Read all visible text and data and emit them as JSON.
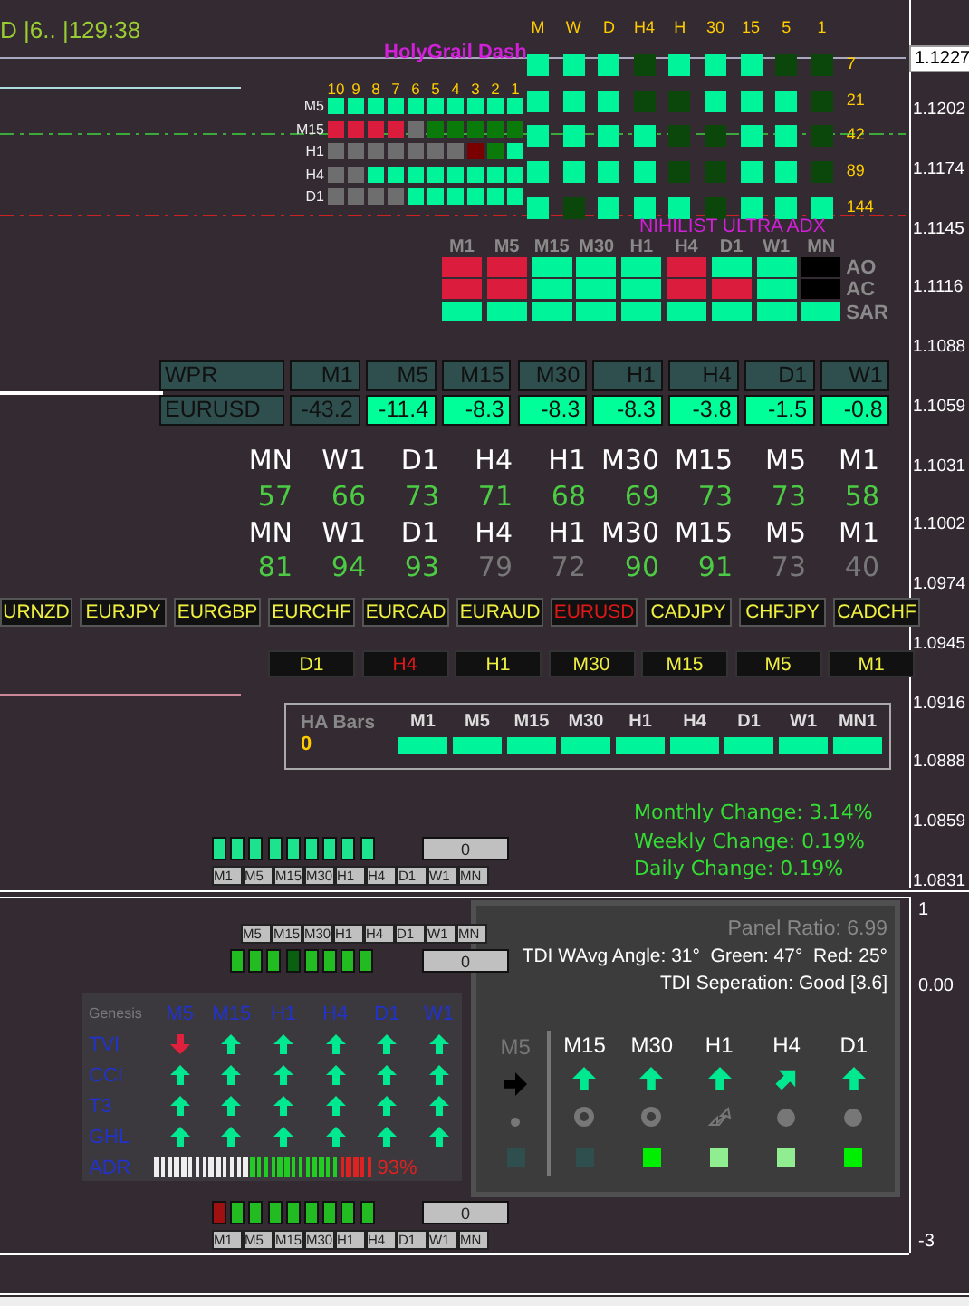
{
  "header": {
    "text": "D |6.. |129:38"
  },
  "price_axis": {
    "current_price": "1.1227",
    "labels": [
      "1.1202",
      "1.1174",
      "1.1145",
      "1.1116",
      "1.1088",
      "1.1059",
      "1.1031",
      "1.1002",
      "1.0974",
      "1.0945",
      "1.0916",
      "1.0888",
      "1.0859",
      "1.0831"
    ]
  },
  "holygrail": {
    "title": "HolyGrail Dash",
    "columns": [
      "M",
      "W",
      "D",
      "H4",
      "H",
      "30",
      "15",
      "5",
      "1"
    ],
    "rows": [
      {
        "label": "7",
        "cells": [
          {
            "on": true
          },
          {
            "on": true
          },
          {
            "on": true
          },
          {
            "on": false
          },
          {
            "on": true
          },
          {
            "on": true
          },
          {
            "on": true
          },
          {
            "on": false
          },
          {
            "on": false
          }
        ]
      },
      {
        "label": "21",
        "cells": [
          {
            "on": true
          },
          {
            "on": true
          },
          {
            "on": true
          },
          {
            "on": false
          },
          {
            "on": false
          },
          {
            "on": true
          },
          {
            "on": true
          },
          {
            "on": true
          },
          {
            "on": false
          }
        ]
      },
      {
        "label": "42",
        "cells": [
          {
            "on": true
          },
          {
            "on": true
          },
          {
            "on": true
          },
          {
            "on": true
          },
          {
            "on": false
          },
          {
            "on": false
          },
          {
            "on": true
          },
          {
            "on": true
          },
          {
            "on": false
          }
        ]
      },
      {
        "label": "89",
        "cells": [
          {
            "on": true
          },
          {
            "on": true
          },
          {
            "on": true
          },
          {
            "on": true
          },
          {
            "on": false
          },
          {
            "on": false
          },
          {
            "on": true
          },
          {
            "on": true
          },
          {
            "on": false
          }
        ]
      },
      {
        "label": "144",
        "cells": [
          {
            "on": true
          },
          {
            "on": false
          },
          {
            "on": true
          },
          {
            "on": true
          },
          {
            "on": true
          },
          {
            "on": false
          },
          {
            "on": true
          },
          {
            "on": true
          },
          {
            "on": true
          }
        ]
      }
    ]
  },
  "signal_grid": {
    "columns": [
      "10",
      "9",
      "8",
      "7",
      "6",
      "5",
      "4",
      "3",
      "2",
      "1"
    ],
    "rows": [
      {
        "label": "M5",
        "cells": [
          {
            "color": "#00f59a"
          },
          {
            "color": "#00f59a"
          },
          {
            "color": "#00f59a"
          },
          {
            "color": "#00f59a"
          },
          {
            "color": "#00f59a"
          },
          {
            "color": "#00f59a"
          },
          {
            "color": "#00f59a"
          },
          {
            "color": "#00f59a"
          },
          {
            "color": "#00f59a"
          },
          {
            "color": "#00f59a"
          }
        ]
      },
      {
        "label": "M15",
        "cells": [
          {
            "color": "#dc1c3c"
          },
          {
            "color": "#dc1c3c"
          },
          {
            "color": "#dc1c3c"
          },
          {
            "color": "#dc1c3c"
          },
          {
            "color": "#6e6e6e"
          },
          {
            "color": "#0a7a0a"
          },
          {
            "color": "#0a7a0a"
          },
          {
            "color": "#0a7a0a"
          },
          {
            "color": "#0a7a0a"
          },
          {
            "color": "#0a7a0a"
          }
        ]
      },
      {
        "label": "H1",
        "cells": [
          {
            "color": "#6e6e6e"
          },
          {
            "color": "#6e6e6e"
          },
          {
            "color": "#6e6e6e"
          },
          {
            "color": "#6e6e6e"
          },
          {
            "color": "#6e6e6e"
          },
          {
            "color": "#6e6e6e"
          },
          {
            "color": "#6e6e6e"
          },
          {
            "color": "#7a0000"
          },
          {
            "color": "#0a7a0a"
          },
          {
            "color": "#00f59a"
          }
        ]
      },
      {
        "label": "H4",
        "cells": [
          {
            "color": "#6e6e6e"
          },
          {
            "color": "#6e6e6e"
          },
          {
            "color": "#00f59a"
          },
          {
            "color": "#00f59a"
          },
          {
            "color": "#00f59a"
          },
          {
            "color": "#00f59a"
          },
          {
            "color": "#00f59a"
          },
          {
            "color": "#00f59a"
          },
          {
            "color": "#00f59a"
          },
          {
            "color": "#00f59a"
          }
        ]
      },
      {
        "label": "D1",
        "cells": [
          {
            "color": "#6e6e6e"
          },
          {
            "color": "#6e6e6e"
          },
          {
            "color": "#6e6e6e"
          },
          {
            "color": "#6e6e6e"
          },
          {
            "color": "#00f59a"
          },
          {
            "color": "#00f59a"
          },
          {
            "color": "#00f59a"
          },
          {
            "color": "#00f59a"
          },
          {
            "color": "#00f59a"
          },
          {
            "color": "#00f59a"
          }
        ]
      }
    ]
  },
  "adx": {
    "title": "NIHILIST ULTRA ADX",
    "columns": [
      "M1",
      "M5",
      "M15",
      "M30",
      "H1",
      "H4",
      "D1",
      "W1",
      "MN"
    ],
    "rows": [
      {
        "label": "AO",
        "cells": [
          {
            "color": "#dc1c3c"
          },
          {
            "color": "#dc1c3c"
          },
          {
            "color": "#00f59a"
          },
          {
            "color": "#00f59a"
          },
          {
            "color": "#00f59a"
          },
          {
            "color": "#dc1c3c"
          },
          {
            "color": "#00f59a"
          },
          {
            "color": "#00f59a"
          },
          {
            "color": "#000000"
          }
        ]
      },
      {
        "label": "AC",
        "cells": [
          {
            "color": "#dc1c3c"
          },
          {
            "color": "#dc1c3c"
          },
          {
            "color": "#00f59a"
          },
          {
            "color": "#00f59a"
          },
          {
            "color": "#00f59a"
          },
          {
            "color": "#dc1c3c"
          },
          {
            "color": "#dc1c3c"
          },
          {
            "color": "#00f59a"
          },
          {
            "color": "#000000"
          }
        ]
      },
      {
        "label": "SAR",
        "cells": [
          {
            "color": "#00f59a"
          },
          {
            "color": "#00f59a"
          },
          {
            "color": "#00f59a"
          },
          {
            "color": "#00f59a"
          },
          {
            "color": "#00f59a"
          },
          {
            "color": "#00f59a"
          },
          {
            "color": "#00f59a"
          },
          {
            "color": "#00f59a"
          },
          {
            "color": "#00f59a"
          }
        ]
      }
    ]
  },
  "wpr": {
    "label": "WPR",
    "columns": [
      "M1",
      "M5",
      "M15",
      "M30",
      "H1",
      "H4",
      "D1",
      "W1"
    ],
    "symbol": "EURUSD",
    "values": [
      {
        "text": "-43.2",
        "highlight": false
      },
      {
        "text": "-11.4",
        "highlight": true
      },
      {
        "text": "-8.3",
        "highlight": true
      },
      {
        "text": "-8.3",
        "highlight": true
      },
      {
        "text": "-8.3",
        "highlight": true
      },
      {
        "text": "-3.8",
        "highlight": true
      },
      {
        "text": "-1.5",
        "highlight": true
      },
      {
        "text": "-0.8",
        "highlight": true
      }
    ]
  },
  "strength": {
    "blocks": [
      {
        "labels": [
          "MN",
          "W1",
          "D1",
          "H4",
          "H1",
          "M30",
          "M15",
          "M5",
          "M1"
        ],
        "values": [
          {
            "text": "57",
            "strong": true
          },
          {
            "text": "66",
            "strong": true
          },
          {
            "text": "73",
            "strong": true
          },
          {
            "text": "71",
            "strong": true
          },
          {
            "text": "68",
            "strong": true
          },
          {
            "text": "69",
            "strong": true
          },
          {
            "text": "73",
            "strong": true
          },
          {
            "text": "73",
            "strong": true
          },
          {
            "text": "58",
            "strong": true
          }
        ]
      },
      {
        "labels": [
          "MN",
          "W1",
          "D1",
          "H4",
          "H1",
          "M30",
          "M15",
          "M5",
          "M1"
        ],
        "values": [
          {
            "text": "81",
            "strong": true
          },
          {
            "text": "94",
            "strong": true
          },
          {
            "text": "93",
            "strong": true
          },
          {
            "text": "79",
            "strong": false
          },
          {
            "text": "72",
            "strong": false
          },
          {
            "text": "90",
            "strong": true
          },
          {
            "text": "91",
            "strong": true
          },
          {
            "text": "73",
            "strong": false
          },
          {
            "text": "40",
            "strong": false
          }
        ]
      }
    ]
  },
  "pairs": [
    {
      "label": "URNZD",
      "selected": false
    },
    {
      "label": "EURJPY",
      "selected": false
    },
    {
      "label": "EURGBP",
      "selected": false
    },
    {
      "label": "EURCHF",
      "selected": false
    },
    {
      "label": "EURCAD",
      "selected": false
    },
    {
      "label": "EURAUD",
      "selected": false
    },
    {
      "label": "EURUSD",
      "selected": true
    },
    {
      "label": "CADJPY",
      "selected": false
    },
    {
      "label": "CHFJPY",
      "selected": false
    },
    {
      "label": "CADCHF",
      "selected": false
    }
  ],
  "timeframes": [
    {
      "label": "D1",
      "selected": false
    },
    {
      "label": "H4",
      "selected": true
    },
    {
      "label": "H1",
      "selected": false
    },
    {
      "label": "M30",
      "selected": false
    },
    {
      "label": "M15",
      "selected": false
    },
    {
      "label": "M5",
      "selected": false
    },
    {
      "label": "M1",
      "selected": false
    }
  ],
  "ha_bars": {
    "title": "HA Bars",
    "count": "0",
    "columns": [
      {
        "label": "M1",
        "on": true
      },
      {
        "label": "M5",
        "on": true
      },
      {
        "label": "M15",
        "on": true
      },
      {
        "label": "M30",
        "on": true
      },
      {
        "label": "H1",
        "on": true
      },
      {
        "label": "H4",
        "on": true
      },
      {
        "label": "D1",
        "on": true
      },
      {
        "label": "W1",
        "on": true
      },
      {
        "label": "MN1",
        "on": true
      }
    ]
  },
  "changes": [
    "Monthly Change: 3.14%",
    "Weekly Change: 0.19%",
    "Daily Change: 0.19%"
  ],
  "strips": [
    {
      "kind": "labels_below",
      "bars": [
        {
          "color": "#1de28e"
        },
        {
          "color": "#1de28e"
        },
        {
          "color": "#1de28e"
        },
        {
          "color": "#1de28e"
        },
        {
          "color": "#1de28e"
        },
        {
          "color": "#1de28e"
        },
        {
          "color": "#1de28e"
        },
        {
          "color": "#1de28e"
        },
        {
          "color": "#1de28e"
        }
      ],
      "count": "0",
      "labels": [
        "M1",
        "M5",
        "M15",
        "M30",
        "H1",
        "H4",
        "D1",
        "W1",
        "MN"
      ]
    },
    {
      "kind": "labels_above",
      "bars": [
        {
          "color": "#22bb22"
        },
        {
          "color": "#22bb22"
        },
        {
          "color": "#22bb22"
        },
        {
          "color": "#0a6010"
        },
        {
          "color": "#22bb22"
        },
        {
          "color": "#22bb22"
        },
        {
          "color": "#22bb22"
        },
        {
          "color": "#22bb22"
        }
      ],
      "count": "0",
      "labels": [
        "M5",
        "M15",
        "M30",
        "H1",
        "H4",
        "D1",
        "W1",
        "MN"
      ]
    },
    {
      "kind": "labels_below",
      "bars": [
        {
          "color": "#a01010"
        },
        {
          "color": "#22bb22"
        },
        {
          "color": "#22bb22"
        },
        {
          "color": "#22bb22"
        },
        {
          "color": "#22bb22"
        },
        {
          "color": "#22bb22"
        },
        {
          "color": "#22bb22"
        },
        {
          "color": "#22bb22"
        },
        {
          "color": "#22bb22"
        }
      ],
      "count": "0",
      "labels": [
        "M1",
        "M5",
        "M15",
        "M30",
        "H1",
        "H4",
        "D1",
        "W1",
        "MN"
      ]
    }
  ],
  "genesis": {
    "title": "Genesis",
    "columns": [
      "M5",
      "M15",
      "H1",
      "H4",
      "D1",
      "W1"
    ],
    "rows": [
      {
        "label": "TVI",
        "arrows": [
          {
            "kind": "down"
          },
          {
            "kind": "up"
          },
          {
            "kind": "up"
          },
          {
            "kind": "up"
          },
          {
            "kind": "up"
          },
          {
            "kind": "up"
          }
        ]
      },
      {
        "label": "CCI",
        "arrows": [
          {
            "kind": "up"
          },
          {
            "kind": "up"
          },
          {
            "kind": "up"
          },
          {
            "kind": "up"
          },
          {
            "kind": "up"
          },
          {
            "kind": "up"
          }
        ]
      },
      {
        "label": "T3",
        "arrows": [
          {
            "kind": "up"
          },
          {
            "kind": "up"
          },
          {
            "kind": "up"
          },
          {
            "kind": "up"
          },
          {
            "kind": "up"
          },
          {
            "kind": "up"
          }
        ]
      },
      {
        "label": "GHL",
        "arrows": [
          {
            "kind": "up"
          },
          {
            "kind": "up"
          },
          {
            "kind": "up"
          },
          {
            "kind": "up"
          },
          {
            "kind": "up"
          },
          {
            "kind": "up"
          }
        ]
      }
    ],
    "adr": {
      "label": "ADR",
      "segments": [
        {
          "color": "#eeeeee"
        },
        {
          "color": "#eeeeee"
        },
        {
          "color": "#eeeeee"
        },
        {
          "color": "#eeeeee"
        },
        {
          "color": "#eeeeee"
        },
        {
          "color": "#eeeeee"
        },
        {
          "color": "#eeeeee"
        },
        {
          "color": "#eeeeee"
        },
        {
          "color": "#eeeeee"
        },
        {
          "color": "#eeeeee"
        },
        {
          "color": "#eeeeee"
        },
        {
          "color": "#eeeeee"
        },
        {
          "color": "#eeeeee"
        },
        {
          "color": "#eeeeee"
        },
        {
          "color": "#22cc22"
        },
        {
          "color": "#22cc22"
        },
        {
          "color": "#22cc22"
        },
        {
          "color": "#22cc22"
        },
        {
          "color": "#22cc22"
        },
        {
          "color": "#22cc22"
        },
        {
          "color": "#22cc22"
        },
        {
          "color": "#22cc22"
        },
        {
          "color": "#22cc22"
        },
        {
          "color": "#22cc22"
        },
        {
          "color": "#22cc22"
        },
        {
          "color": "#22cc22"
        },
        {
          "color": "#22cc22"
        },
        {
          "color": "#dd2222"
        },
        {
          "color": "#dd2222"
        },
        {
          "color": "#dd2222"
        },
        {
          "color": "#dd2222"
        },
        {
          "color": "#dd2222"
        }
      ],
      "reading": "93%"
    }
  },
  "tdi": {
    "panel_ratio": "Panel Ratio: 6.99",
    "angle": "TDI WAvg Angle: 31°  Green: 47°  Red: 25°",
    "separation": "TDI Seperation: Good [3.6]",
    "columns": [
      {
        "label": "M5",
        "dimmed": true,
        "arrow": {
          "kind": "right"
        },
        "marker": {
          "kind": "dot"
        },
        "color": "#2f4f4f"
      },
      {
        "label": "M15",
        "dimmed": false,
        "arrow": {
          "kind": "up"
        },
        "marker": {
          "kind": "ring"
        },
        "color": "#2f4f4f"
      },
      {
        "label": "M30",
        "dimmed": false,
        "arrow": {
          "kind": "up"
        },
        "marker": {
          "kind": "ring"
        },
        "color": "#00ee00"
      },
      {
        "label": "H1",
        "dimmed": false,
        "arrow": {
          "kind": "up"
        },
        "marker": {
          "kind": "outline"
        },
        "color": "#90ee90"
      },
      {
        "label": "H4",
        "dimmed": false,
        "arrow": {
          "kind": "up_right"
        },
        "marker": {
          "kind": "disc"
        },
        "color": "#90ee90"
      },
      {
        "label": "D1",
        "dimmed": false,
        "arrow": {
          "kind": "up"
        },
        "marker": {
          "kind": "disc"
        },
        "color": "#00ee00"
      }
    ]
  },
  "sub_axis": {
    "labels": [
      "1",
      "0.00",
      "-3"
    ]
  }
}
